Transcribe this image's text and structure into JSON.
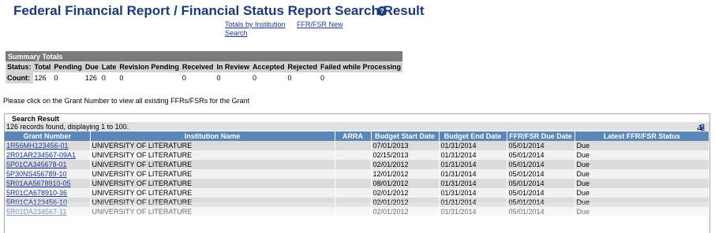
{
  "page": {
    "title": "Federal Financial Report / Financial Status Report Search Result",
    "help_icon": "?"
  },
  "links": {
    "totals_line1": "Totals by Institution",
    "totals_line2": "Search",
    "ffr_new": "FFR/FSR New"
  },
  "summary": {
    "title": "Summary Totals",
    "row_status_label": "Status:",
    "row_count_label": "Count:",
    "columns": [
      "Total",
      "Pending",
      "Due",
      "Late",
      "Revision Pending",
      "Received",
      "In Review",
      "Accepted",
      "Rejected",
      "Failed while Processing"
    ],
    "counts": [
      "126",
      "0",
      "126",
      "0",
      "0",
      "0",
      "0",
      "0",
      "0",
      "0"
    ]
  },
  "instructions": "Please click on the Grant Number to view all existing FFRs/FSRs for the Grant",
  "results": {
    "title": "Search Result",
    "records_text": "126 records found, displaying 1 to 100.",
    "pager": {
      "current": "1",
      "next": "2",
      "next_arrow": "→",
      "last_arrow": "⇥"
    },
    "columns": [
      "Grant Number",
      "Institution Name",
      "ARRA",
      "Budget Start Date",
      "Budget End Date",
      "FFR/FSR Due Date",
      "Latest FFR/FSR Status"
    ],
    "rows": [
      {
        "grant": "1R56MH123456-01",
        "inst": "UNIVERSITY OF LITERATURE",
        "arra": "",
        "start": "07/01/2013",
        "end": "01/31/2014",
        "due": "05/01/2014",
        "status": "Due"
      },
      {
        "grant": "2R01AR234567-09A1",
        "inst": "UNIVERSITY OF LITERATURE",
        "arra": "",
        "start": "02/15/2013",
        "end": "01/31/2014",
        "due": "05/01/2014",
        "status": "Due"
      },
      {
        "grant": "5P01CA345678-01",
        "inst": "UNIVERSITY OF LITERATURE",
        "arra": "",
        "start": "02/01/2012",
        "end": "01/31/2014",
        "due": "05/01/2014",
        "status": "Due"
      },
      {
        "grant": "5P30NS456789-10",
        "inst": "UNIVERSITY OF LITERATURE",
        "arra": "",
        "start": "12/01/2012",
        "end": "01/31/2014",
        "due": "05/01/2014",
        "status": "Due"
      },
      {
        "grant": "5R01AA5678910-05",
        "inst": "UNIVERSITY OF LITERATURE",
        "arra": "",
        "start": "08/01/2012",
        "end": "01/31/2014",
        "due": "05/01/2014",
        "status": "Due"
      },
      {
        "grant": "5R01CA678910-36",
        "inst": "UNIVERSITY OF LITERATURE",
        "arra": "",
        "start": "02/01/2012",
        "end": "01/31/2014",
        "due": "05/01/2014",
        "status": "Due"
      },
      {
        "grant": "5R01CA123456-10",
        "inst": "UNIVERSITY OF LITERATURE",
        "arra": "",
        "start": "02/01/2012",
        "end": "01/31/2014",
        "due": "05/01/2014",
        "status": "Due"
      },
      {
        "grant": "5R01DA234567-11",
        "inst": "UNIVERSITY OF LITERATURE",
        "arra": "",
        "start": "02/01/2012",
        "end": "01/31/2014",
        "due": "05/01/2014",
        "status": "Due"
      }
    ]
  }
}
